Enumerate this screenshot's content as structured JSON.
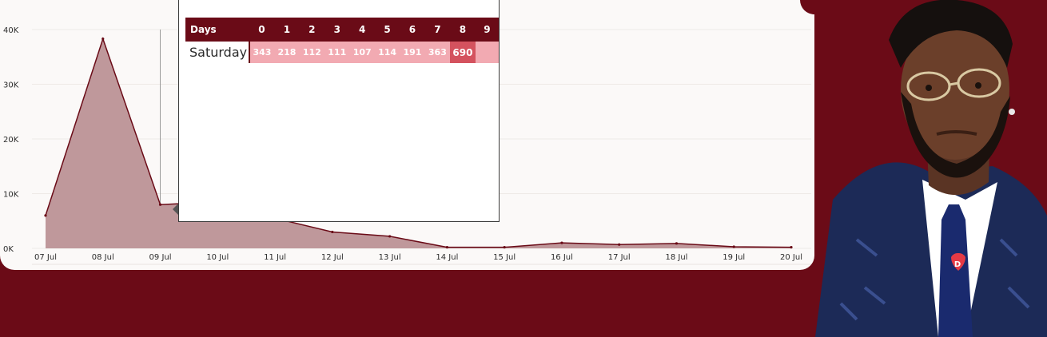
{
  "chart_data": {
    "type": "area",
    "x": [
      "07 Jul",
      "08 Jul",
      "09 Jul",
      "10 Jul",
      "11 Jul",
      "12 Jul",
      "13 Jul",
      "14 Jul",
      "15 Jul",
      "16 Jul",
      "17 Jul",
      "18 Jul",
      "19 Jul",
      "20 Jul"
    ],
    "values": [
      6000,
      38300,
      8000,
      8500,
      5500,
      3000,
      2200,
      200,
      200,
      1000,
      700,
      900,
      300,
      200
    ],
    "ylim": [
      0,
      40000
    ],
    "y_ticks": [
      "0K",
      "10K",
      "20K",
      "30K",
      "40K"
    ],
    "title": "",
    "xlabel": "",
    "ylabel": "",
    "grid": true,
    "colors": {
      "line": "#6a0b17",
      "fill": "#bf989b"
    }
  },
  "tooltip": {
    "header_label": "Days",
    "columns": [
      "0",
      "1",
      "2",
      "3",
      "4",
      "5",
      "6",
      "7",
      "8",
      "9"
    ],
    "row_label": "Saturday",
    "values": [
      "343",
      "218",
      "112",
      "111",
      "107",
      "114",
      "191",
      "363",
      "690"
    ],
    "colors": {
      "header": "#6a0b17",
      "cell": "#f2aab2",
      "highlight": "#d4525e"
    }
  },
  "photo": {
    "subject": "man-portrait",
    "pin_letter": "D"
  }
}
